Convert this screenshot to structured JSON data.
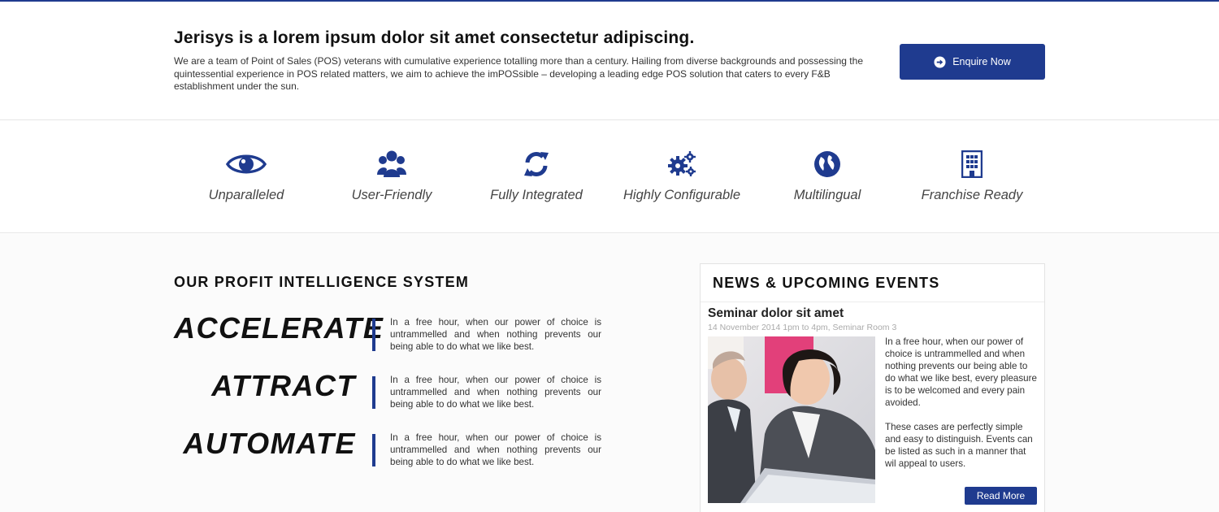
{
  "intro": {
    "title": "Jerisys is a lorem ipsum dolor sit amet consectetur adipiscing.",
    "text": "We are a team of Point of Sales (POS) veterans with cumulative experience totalling more than a century. Hailing from diverse backgrounds and possessing the quintessential experience in POS related matters, we aim to achieve the imPOSsible – developing a leading edge POS solution that caters to every F&B establishment under the sun.",
    "button_label": "Enquire Now"
  },
  "features": [
    {
      "label": "Unparalleled",
      "icon": "eye-icon"
    },
    {
      "label": "User-Friendly",
      "icon": "users-icon"
    },
    {
      "label": "Fully Integrated",
      "icon": "refresh-icon"
    },
    {
      "label": "Highly Configurable",
      "icon": "gears-icon"
    },
    {
      "label": "Multilingual",
      "icon": "globe-icon"
    },
    {
      "label": "Franchise Ready",
      "icon": "building-icon"
    }
  ],
  "profit": {
    "title": "OUR PROFIT INTELLIGENCE SYSTEM",
    "items": [
      {
        "word": "ACCELERATE",
        "text": "In a free hour, when our power of choice is untrammelled and when nothing prevents our being able to do what we like best."
      },
      {
        "word": "ATTRACT",
        "text": "In a free hour, when our power of choice is untrammelled and when nothing prevents our being able to do what we like best."
      },
      {
        "word": "AUTOMATE",
        "text": "In a free hour, when our power of choice is untrammelled and when nothing prevents our being able to do what we like best."
      }
    ]
  },
  "news": {
    "title": "NEWS & UPCOMING EVENTS",
    "event": {
      "title": "Seminar dolor sit amet",
      "meta": "14 November 2014 1pm to 4pm, Seminar Room 3",
      "paragraph1": "In a free hour, when our power of choice is untrammelled and when nothing prevents our being able to do what we like best, every pleasure is to be welcomed and every pain avoided.",
      "paragraph2": "These cases are perfectly simple and easy to distinguish. Events can be listed as such in a manner that wil appeal to users.",
      "read_more": "Read More"
    }
  },
  "colors": {
    "brand": "#1f3b8f",
    "text": "#333333"
  }
}
